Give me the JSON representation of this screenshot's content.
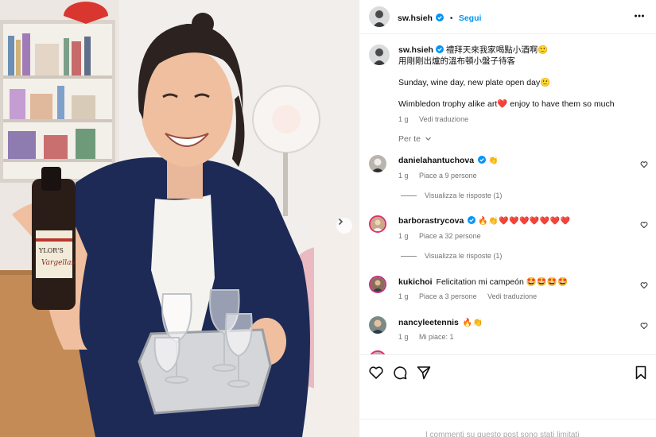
{
  "post": {
    "author": "sw.hsieh",
    "follow_label": "Segui",
    "separator": "•",
    "caption": {
      "line1": "禮拜天來我家喝點小酒啊🙂",
      "line2": "用剛剛出爐的溫布頓小盤子待客",
      "line3": "Sunday, wine day, new plate open day🙂",
      "line4": "Wimbledon trophy alike art❤️ enjoy to have them so much",
      "time": "1 g",
      "translate": "Vedi traduzione"
    }
  },
  "for_you_label": "Per te",
  "comments": [
    {
      "username": "danielahantuchova",
      "verified": true,
      "text": "👏",
      "time": "1 g",
      "likes": "Piace a 9 persone",
      "replies": "Visualizza le risposte (1)",
      "avatar_color": "#b9b4ad"
    },
    {
      "username": "barborastrycova",
      "verified": true,
      "text": "🔥👏❤️❤️❤️❤️❤️❤️❤️",
      "time": "1 g",
      "likes": "Piace a 32 persone",
      "replies": "Visualizza le risposte (1)",
      "avatar_color": "#c9a88a"
    },
    {
      "username": "kukichoi",
      "verified": false,
      "text": "Felicitation mi campeón 🤩🤩🤩🤩",
      "time": "1 g",
      "likes": "Piace a 3 persone",
      "translate": "Vedi traduzione",
      "avatar_color": "#8a6c5a"
    },
    {
      "username": "nancyleetennis",
      "verified": false,
      "text": "🔥👏",
      "time": "1 g",
      "likes": "Mi piace: 1",
      "avatar_color": "#7b8a84"
    }
  ],
  "footer": {
    "disabled_notice": "I commenti su questo post sono stati limitati"
  },
  "colors": {
    "accent": "#0095f6",
    "verified": "#0095f6",
    "muted": "#737373",
    "divider": "#efefef"
  },
  "icons": {
    "more": "more-horizontal-icon",
    "like": "heart-icon",
    "comment": "comment-icon",
    "share": "share-icon",
    "save": "bookmark-icon",
    "next": "chevron-right-icon"
  }
}
